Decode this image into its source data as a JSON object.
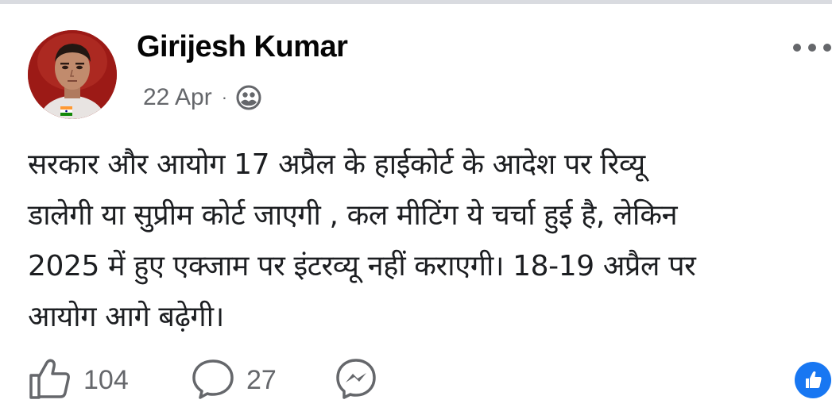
{
  "post": {
    "author": "Girijesh Kumar",
    "date": "22 Apr",
    "separator": "·",
    "privacy_icon": "friends-icon",
    "body_lines": [
      "सरकार और आयोग 17 अप्रैल के हाईकोर्ट के आदेश पर रिव्यू",
      "डालेगी या सुप्रीम कोर्ट जाएगी , कल मीटिंग ये चर्चा हुई है, लेकिन",
      "2025 में हुए एक्जाम पर इंटरव्यू नहीं कराएगी। 18-19 अप्रैल पर",
      "आयोग आगे बढ़ेगी।"
    ]
  },
  "actions": {
    "like_count": "104",
    "comment_count": "27",
    "like_icon": "thumbs-up-icon",
    "comment_icon": "comment-bubble-icon",
    "share_icon": "messenger-icon",
    "reaction_icon": "like-reaction-icon"
  },
  "colors": {
    "accent": "#1877f2",
    "secondary_text": "#65676b",
    "primary_text": "#050505"
  }
}
